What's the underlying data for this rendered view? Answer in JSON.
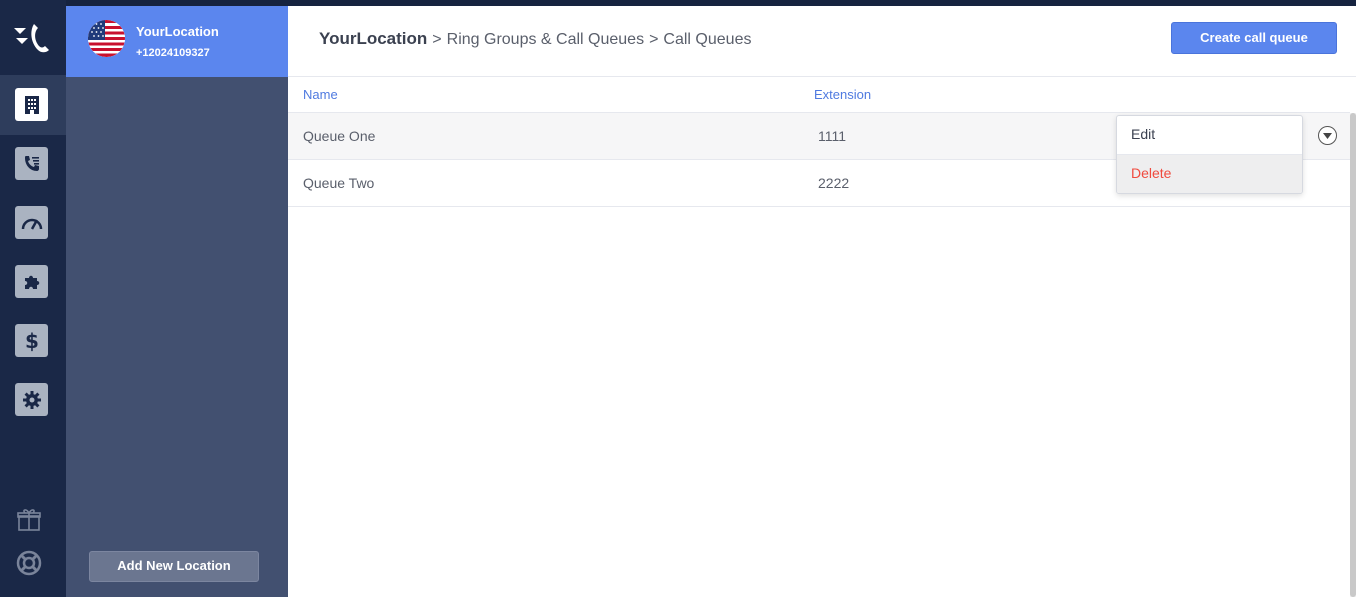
{
  "location": {
    "name": "YourLocation",
    "phone": "+12024109327",
    "add_button": "Add New Location"
  },
  "nav": {
    "items": [
      {
        "icon": "building-icon",
        "active": true
      },
      {
        "icon": "call-queue-icon",
        "active": false
      },
      {
        "icon": "speedometer-icon",
        "active": false
      },
      {
        "icon": "puzzle-icon",
        "active": false
      },
      {
        "icon": "dollar-icon",
        "active": false
      },
      {
        "icon": "gear-icon",
        "active": false
      }
    ],
    "bottom": [
      "gift-icon",
      "lifebuoy-icon"
    ]
  },
  "header": {
    "breadcrumb": {
      "root": "YourLocation",
      "separator": ">",
      "level1": "Ring Groups & Call Queues",
      "level2": "Call Queues"
    },
    "create_button": "Create call queue"
  },
  "table": {
    "columns": {
      "name": "Name",
      "extension": "Extension"
    },
    "rows": [
      {
        "name": "Queue One",
        "extension": "1111"
      },
      {
        "name": "Queue Two",
        "extension": "2222"
      }
    ]
  },
  "dropdown": {
    "edit": "Edit",
    "delete": "Delete"
  },
  "colors": {
    "accent": "#5b86ee",
    "sidebar": "#1a2847",
    "panel": "#425070",
    "danger": "#f04a3e"
  }
}
